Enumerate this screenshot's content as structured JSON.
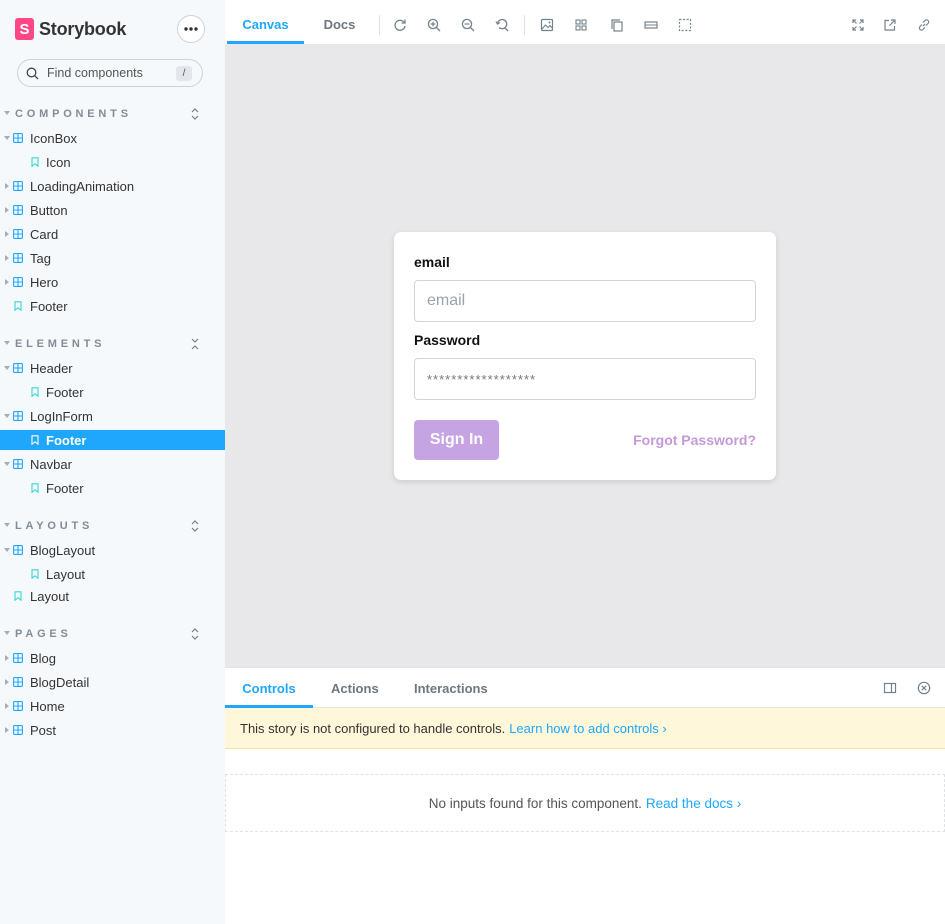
{
  "sidebar": {
    "brand": {
      "logo_letter": "S",
      "title": "Storybook"
    },
    "menu_icon": "ellipsis-icon",
    "search": {
      "placeholder": "Find components",
      "shortcut": "/"
    },
    "sections": [
      {
        "label": "COMPONENTS",
        "toggle_icon": "expand-collapse-icon"
      },
      {
        "label": "ELEMENTS",
        "toggle_icon": "collapse-icon"
      },
      {
        "label": "LAYOUTS",
        "toggle_icon": "expand-collapse-icon"
      },
      {
        "label": "PAGES",
        "toggle_icon": "expand-collapse-icon"
      }
    ],
    "items": [
      {
        "label": "IconBox",
        "type": "component",
        "expanded": true
      },
      {
        "label": "Icon",
        "type": "story"
      },
      {
        "label": "LoadingAnimation",
        "type": "component",
        "expanded": false
      },
      {
        "label": "Button",
        "type": "component",
        "expanded": false
      },
      {
        "label": "Card",
        "type": "component",
        "expanded": false
      },
      {
        "label": "Tag",
        "type": "component",
        "expanded": false
      },
      {
        "label": "Hero",
        "type": "component",
        "expanded": false
      },
      {
        "label": "Footer",
        "type": "story"
      },
      {
        "label": "Header",
        "type": "component",
        "expanded": true
      },
      {
        "label": "Footer",
        "type": "story"
      },
      {
        "label": "LogInForm",
        "type": "component",
        "expanded": true
      },
      {
        "label": "Footer",
        "type": "story",
        "selected": true
      },
      {
        "label": "Navbar",
        "type": "component",
        "expanded": true
      },
      {
        "label": "Footer",
        "type": "story"
      },
      {
        "label": "BlogLayout",
        "type": "component",
        "expanded": true
      },
      {
        "label": "Layout",
        "type": "story"
      },
      {
        "label": "Layout",
        "type": "story"
      },
      {
        "label": "Blog",
        "type": "component",
        "expanded": false
      },
      {
        "label": "BlogDetail",
        "type": "component",
        "expanded": false
      },
      {
        "label": "Home",
        "type": "component",
        "expanded": false
      },
      {
        "label": "Post",
        "type": "component",
        "expanded": false
      }
    ]
  },
  "toolbar": {
    "tabs": [
      {
        "label": "Canvas",
        "active": true
      },
      {
        "label": "Docs",
        "active": false
      }
    ],
    "left_icons": [
      "reload-icon",
      "zoom-in-icon",
      "zoom-out-icon",
      "zoom-reset-icon",
      "background-icon",
      "grid-icon",
      "viewport-icon",
      "measure-icon",
      "outline-icon"
    ],
    "right_icons": [
      "fullscreen-icon",
      "open-new-tab-icon",
      "copy-link-icon"
    ]
  },
  "login_form": {
    "email_label": "email",
    "email_placeholder": "email",
    "password_label": "Password",
    "password_value": "******************",
    "signin_label": "Sign In",
    "forgot_label": "Forgot Password?"
  },
  "addons": {
    "tabs": [
      {
        "label": "Controls",
        "active": true
      },
      {
        "label": "Actions",
        "active": false
      },
      {
        "label": "Interactions",
        "active": false
      }
    ],
    "notice_text": "This story is not configured to handle controls.",
    "notice_link": "Learn how to add controls ›",
    "empty_text": "No inputs found for this component.",
    "empty_link": "Read the docs ›",
    "right_icons": [
      "panel-orientation-icon",
      "close-panel-icon"
    ]
  },
  "colors": {
    "accent": "#1ea7fd",
    "brand_pink": "#ff4785",
    "signin_button": "#c6a3e3",
    "forgot_link": "#c39ad9",
    "component_icon": "#1ea7fd",
    "story_icon": "#37d5d3"
  }
}
